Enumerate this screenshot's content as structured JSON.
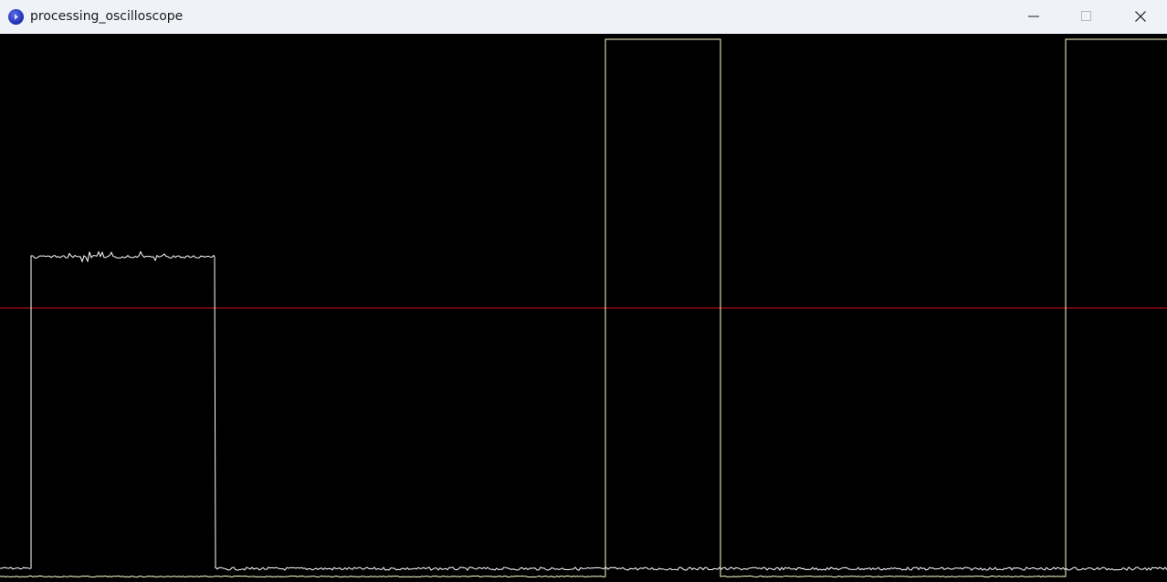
{
  "window": {
    "title": "processing_oscilloscope",
    "app_icon": "processing-app-icon",
    "controls": {
      "minimize_icon": "minimize-icon",
      "maximize_icon": "maximize-icon",
      "close_icon": "close-icon"
    }
  },
  "scope": {
    "background_color": "#000000",
    "trigger_line_color": "#d01010",
    "signal_a_color": "#ffffff",
    "signal_b_color": "#ffffcc"
  }
}
